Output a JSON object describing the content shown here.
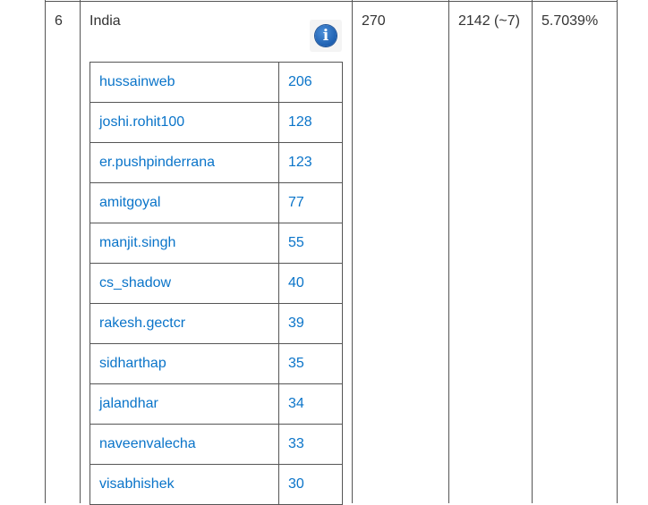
{
  "row": {
    "rank": "6",
    "country": "India",
    "count": "270",
    "total": "2142 (~7)",
    "percent": "5.7039%"
  },
  "info_icon": "info-icon",
  "contributors": [
    {
      "name": "hussainweb",
      "count": "206"
    },
    {
      "name": "joshi.rohit100",
      "count": "128"
    },
    {
      "name": "er.pushpinderrana",
      "count": "123"
    },
    {
      "name": "amitgoyal",
      "count": "77"
    },
    {
      "name": "manjit.singh",
      "count": "55"
    },
    {
      "name": "cs_shadow",
      "count": "40"
    },
    {
      "name": "rakesh.gectcr",
      "count": "39"
    },
    {
      "name": "sidharthap",
      "count": "35"
    },
    {
      "name": "jalandhar",
      "count": "34"
    },
    {
      "name": "naveenvalecha",
      "count": "33"
    },
    {
      "name": "visabhishek",
      "count": "30"
    }
  ]
}
